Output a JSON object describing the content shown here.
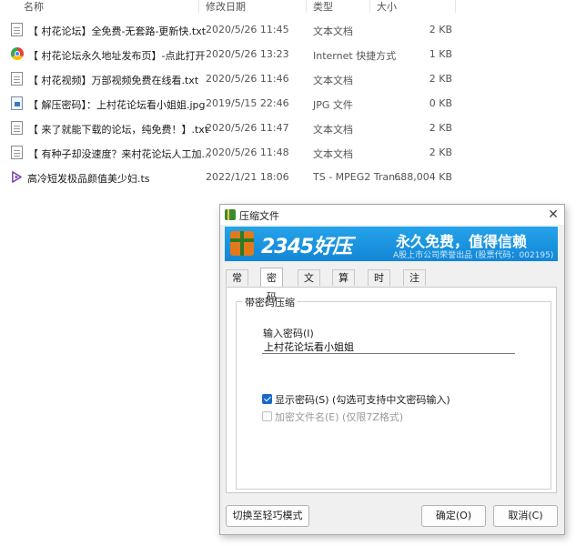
{
  "explorer": {
    "columns": {
      "name": "名称",
      "date": "修改日期",
      "type": "类型",
      "size": "大小"
    },
    "files": [
      {
        "icon": "text-document-icon",
        "name": "【 村花论坛】全免费-无套路-更新快.txt",
        "date": "2020/5/26 11:45",
        "type": "文本文档",
        "size": "2 KB"
      },
      {
        "icon": "internet-shortcut-icon",
        "name": "【 村花论坛永久地址发布页】-点此打开",
        "date": "2020/5/26 13:23",
        "type": "Internet 快捷方式",
        "size": "1 KB"
      },
      {
        "icon": "text-document-icon",
        "name": "【 村花视频】万部视频免费在线看.txt",
        "date": "2020/5/26 11:46",
        "type": "文本文档",
        "size": "2 KB"
      },
      {
        "icon": "image-file-icon",
        "name": "【 解压密码】：上村花论坛看小姐姐.jpg",
        "date": "2019/5/15 22:46",
        "type": "JPG 文件",
        "size": "0 KB"
      },
      {
        "icon": "text-document-icon",
        "name": "【 来了就能下载的论坛，纯免费！】.txt",
        "date": "2020/5/26 11:47",
        "type": "文本文档",
        "size": "2 KB"
      },
      {
        "icon": "text-document-icon",
        "name": "【 有种子却没速度？来村花论坛人工加...",
        "date": "2020/5/26 11:48",
        "type": "文本文档",
        "size": "2 KB"
      },
      {
        "icon": "video-file-icon",
        "name": "高冷短发极品颜值美少妇.ts",
        "date": "2022/1/21 18:06",
        "type": "TS - MPEG2 Tran...",
        "size": "688,004 KB"
      }
    ]
  },
  "dialog": {
    "title": "压缩文件",
    "close_glyph": "✕",
    "banner": {
      "brand": "2345好压",
      "slogan": "永久免费，值得信赖",
      "subtitle": "A股上市公司荣誉出品 (股票代码：002195)",
      "colors": {
        "top": "#24a3ea",
        "bottom": "#1386d6"
      }
    },
    "tabs": [
      "常规",
      "密码",
      "文件",
      "算法",
      "时间",
      "注释"
    ],
    "active_tab": "密码",
    "group_title": "带密码压缩",
    "password_label": "输入密码(I)",
    "password_value": "上村花论坛看小姐姐",
    "show_password": {
      "label": "显示密码(S) (勾选可支持中文密码输入)",
      "checked": true
    },
    "encrypt_names": {
      "label": "加密文件名(E) (仅限7Z格式)",
      "checked": false,
      "enabled": false
    },
    "buttons": {
      "switch_mode": "切换至轻巧模式",
      "ok": "确定(O)",
      "cancel": "取消(C)"
    }
  }
}
